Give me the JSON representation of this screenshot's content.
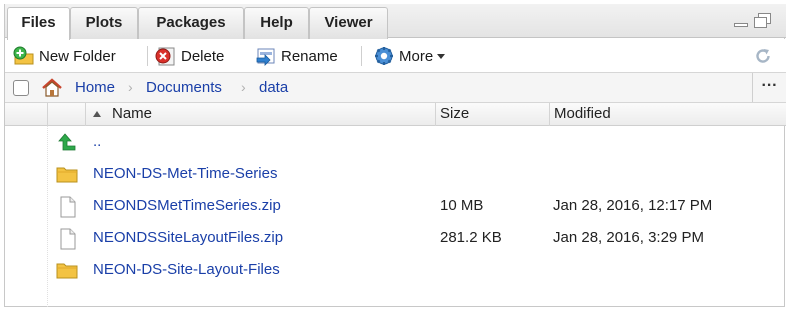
{
  "tabs": [
    {
      "label": "Files",
      "active": true
    },
    {
      "label": "Plots",
      "active": false
    },
    {
      "label": "Packages",
      "active": false
    },
    {
      "label": "Help",
      "active": false
    },
    {
      "label": "Viewer",
      "active": false
    }
  ],
  "toolbar": {
    "new_folder": "New Folder",
    "delete": "Delete",
    "rename": "Rename",
    "more": "More"
  },
  "breadcrumb": [
    "Home",
    "Documents",
    "data"
  ],
  "columns": {
    "name": "Name",
    "size": "Size",
    "modified": "Modified"
  },
  "rows": [
    {
      "name": "..",
      "size": "",
      "modified": "",
      "icon": "up-arrow-icon"
    },
    {
      "name": "NEON-DS-Met-Time-Series",
      "size": "",
      "modified": "",
      "icon": "folder-icon"
    },
    {
      "name": "NEONDSMetTimeSeries.zip",
      "size": "10 MB",
      "modified": "Jan 28, 2016, 12:17 PM",
      "icon": "file-icon"
    },
    {
      "name": "NEONDSSiteLayoutFiles.zip",
      "size": "281.2 KB",
      "modified": "Jan 28, 2016, 3:29 PM",
      "icon": "file-icon"
    },
    {
      "name": "NEON-DS-Site-Layout-Files",
      "size": "",
      "modified": "",
      "icon": "folder-icon"
    }
  ],
  "colors": {
    "link": "#1a3fa8",
    "folder": "#f3c343",
    "up_arrow": "#2da84a"
  }
}
